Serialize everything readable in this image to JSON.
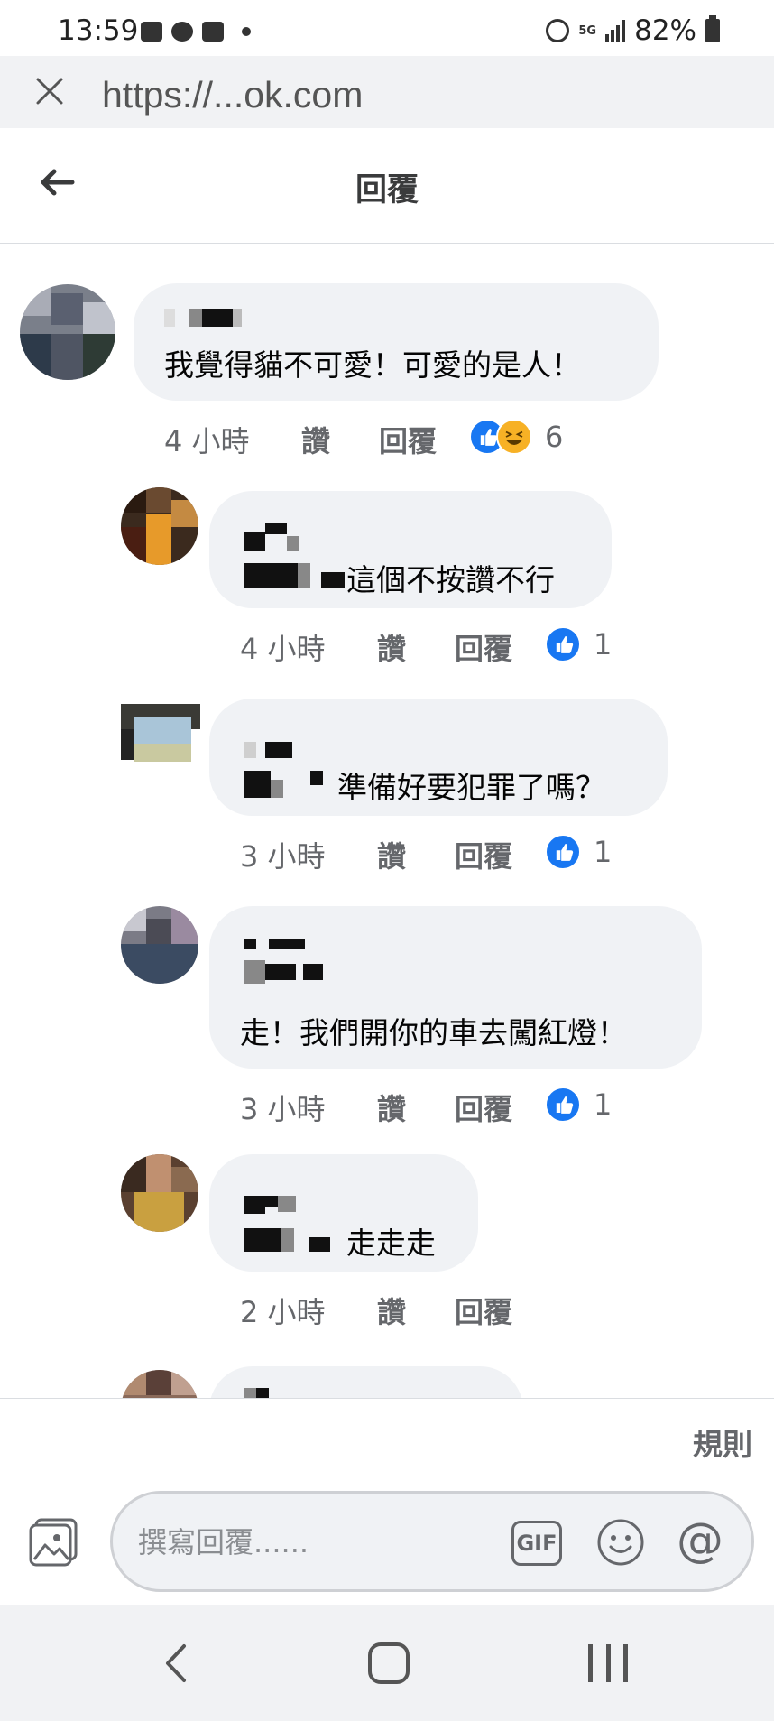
{
  "status_bar": {
    "time": "13:59",
    "network": "5G",
    "battery": "82%"
  },
  "browser": {
    "url": "https://...ok.com",
    "close_icon": "close-icon"
  },
  "header": {
    "title": "回覆",
    "back_icon": "back-arrow-icon"
  },
  "main_comment": {
    "text": "我覺得貓不可愛！可愛的是人！",
    "time": "4 小時",
    "like_label": "讚",
    "reply_label": "回覆",
    "reactions": [
      "like",
      "haha"
    ],
    "reaction_count": "6"
  },
  "replies": [
    {
      "text": "這個不按讚不行",
      "time": "4 小時",
      "like_label": "讚",
      "reply_label": "回覆",
      "reaction_count": "1"
    },
    {
      "text": "準備好要犯罪了嗎？",
      "time": "3 小時",
      "like_label": "讚",
      "reply_label": "回覆",
      "reaction_count": "1"
    },
    {
      "text": "走！我們開你的車去闖紅燈！",
      "time": "3 小時",
      "like_label": "讚",
      "reply_label": "回覆",
      "reaction_count": "1"
    },
    {
      "text": "走走走",
      "time": "2 小時",
      "like_label": "讚",
      "reply_label": "回覆"
    }
  ],
  "footer": {
    "rules_label": "規則",
    "composer_placeholder": "撰寫回覆......",
    "gif_label": "GIF"
  },
  "colors": {
    "accent_like": "#1877f2",
    "haha": "#f7b125",
    "bubble": "#f0f2f5",
    "secondary_text": "#65676b"
  }
}
